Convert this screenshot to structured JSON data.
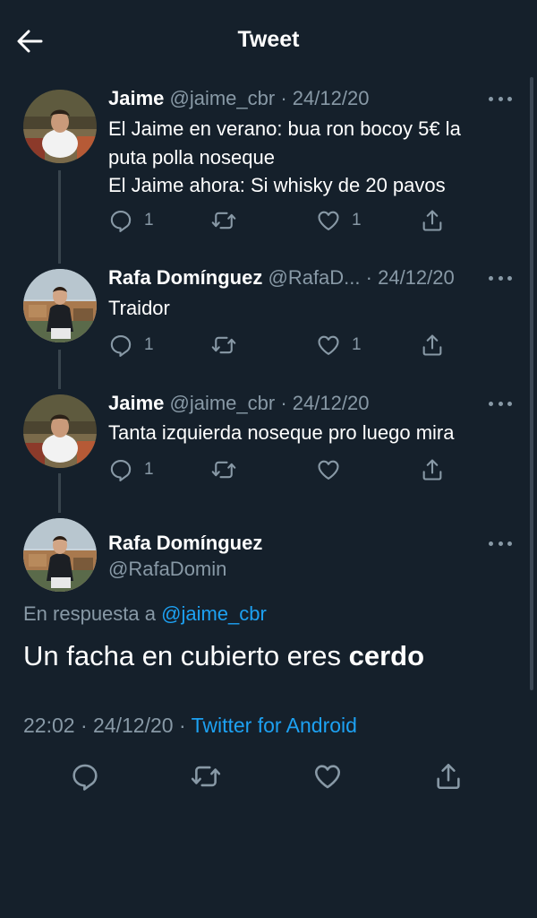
{
  "header": {
    "title": "Tweet",
    "back_icon": "arrow-left-icon"
  },
  "colors": {
    "background": "#15202b",
    "muted": "#8899a6",
    "link": "#1da1f2",
    "thread_line": "#38444d"
  },
  "tweets": [
    {
      "name": "Jaime",
      "handle": "@jaime_cbr",
      "sep": "·",
      "date": "24/12/20",
      "lines": [
        "El Jaime en verano: bua ron bocoy 5€ la",
        "puta polla noseque",
        "El Jaime ahora: Si whisky de 20 pavos"
      ],
      "reply_count": "1",
      "retweet_count": "",
      "like_count": "1"
    },
    {
      "name": "Rafa Domínguez",
      "handle": "@RafaD...",
      "sep": "·",
      "date": "24/12/20",
      "lines": [
        "Traidor"
      ],
      "reply_count": "1",
      "retweet_count": "",
      "like_count": "1"
    },
    {
      "name": "Jaime",
      "handle": "@jaime_cbr",
      "sep": "·",
      "date": "24/12/20",
      "lines": [
        "Tanta izquierda noseque pro luego mira"
      ],
      "reply_count": "1",
      "retweet_count": "",
      "like_count": ""
    }
  ],
  "main_tweet": {
    "name": "Rafa Domínguez",
    "handle": "@RafaDomin",
    "reply_prefix": "En respuesta a",
    "reply_handle": "@jaime_cbr",
    "text_plain": "Un facha en cubierto eres ",
    "text_bold": "cerdo",
    "time": "22:02",
    "sep": "·",
    "date": "24/12/20",
    "sep2": "·",
    "source": "Twitter for Android"
  },
  "icons": [
    "arrow-left-icon",
    "more-icon",
    "reply-icon",
    "retweet-icon",
    "like-icon",
    "share-icon"
  ]
}
